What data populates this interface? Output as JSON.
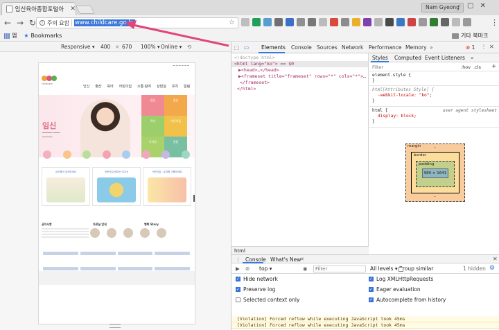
{
  "browser": {
    "tab_title": "임신육아종합포털아",
    "profile_name": "Nam Gyeong",
    "security_label": "주의 요함",
    "url": "www.childcare.go.kr",
    "bookmarks": {
      "apps": "앱",
      "bookmarks": "Bookmarks",
      "other": "기타 북마크"
    }
  },
  "device_toolbar": {
    "device": "Responsive",
    "width": "400",
    "x": "×",
    "height": "670",
    "zoom": "100%",
    "throttle": "Online"
  },
  "site": {
    "hero_word": "임신",
    "nav": [
      "인신",
      "출산",
      "육아",
      "어린이집",
      "소통·참여",
      "상담실",
      "유치",
      "알림"
    ],
    "tiles": [
      "임신",
      "출산",
      "육아",
      "어린이집",
      "유치원",
      "알림"
    ],
    "card_titles": [
      "임신육아 검색하세요",
      "어린이집 정보는 여기서",
      "어린이집 · 유치원 이용하세요"
    ],
    "col_titles": [
      "공지사항",
      "자료실 안내",
      "행복 Story"
    ]
  },
  "devtools": {
    "tabs": [
      "Elements",
      "Console",
      "Sources",
      "Network",
      "Performance",
      "Memory"
    ],
    "error_count": "1",
    "elements": [
      {
        "kind": "comment",
        "text": "<!doctype html>"
      },
      {
        "kind": "selected",
        "text": "<html lang=\"ko\"> == $0"
      },
      {
        "kind": "node",
        "text": "▶<head>…</head>"
      },
      {
        "kind": "node",
        "text": "▶<frameset title=\"frameset\" rows=\"*\" cols=\"*\">…"
      },
      {
        "kind": "node",
        "text": "</frameset>"
      },
      {
        "kind": "node",
        "text": "</html>"
      }
    ],
    "breadcrumb": "html",
    "styles_tabs": [
      "Styles",
      "Computed",
      "Event Listeners"
    ],
    "filter_placeholder": "Filter",
    "hov": ":hov",
    "cls": ".cls",
    "rules": {
      "element_style": "element.style {",
      "attr_sel": "html[Attributes Style] {",
      "attr_prop": "-webkit-locale: \"ko\";",
      "ua_sel": "html {",
      "ua_src": "user agent stylesheet",
      "ua_prop": "display: block;"
    },
    "box_model": {
      "margin": "margin",
      "border": "border",
      "padding": "padding",
      "content": "980 × 1641",
      "dash": "–"
    },
    "drawer": {
      "tabs": [
        "Console",
        "What's New"
      ],
      "context": "top",
      "filter_placeholder": "Filter",
      "levels": "All levels",
      "group_similar": "Group similar",
      "hidden": "1 hidden",
      "options_left": [
        {
          "label": "Hide network",
          "checked": true
        },
        {
          "label": "Preserve log",
          "checked": true
        },
        {
          "label": "Selected context only",
          "checked": false
        }
      ],
      "options_right": [
        {
          "label": "Log XMLHttpRequests",
          "checked": true
        },
        {
          "label": "Eager evaluation",
          "checked": true
        },
        {
          "label": "Autocomplete from history",
          "checked": true
        }
      ],
      "messages": [
        "[Violation] Forced reflow while executing JavaScript took 45ms",
        "[Violation] Forced reflow while executing JavaScript took 45ms"
      ]
    }
  },
  "colors": {
    "accent": "#3879d9",
    "annotation_arrow": "#e0457b"
  }
}
